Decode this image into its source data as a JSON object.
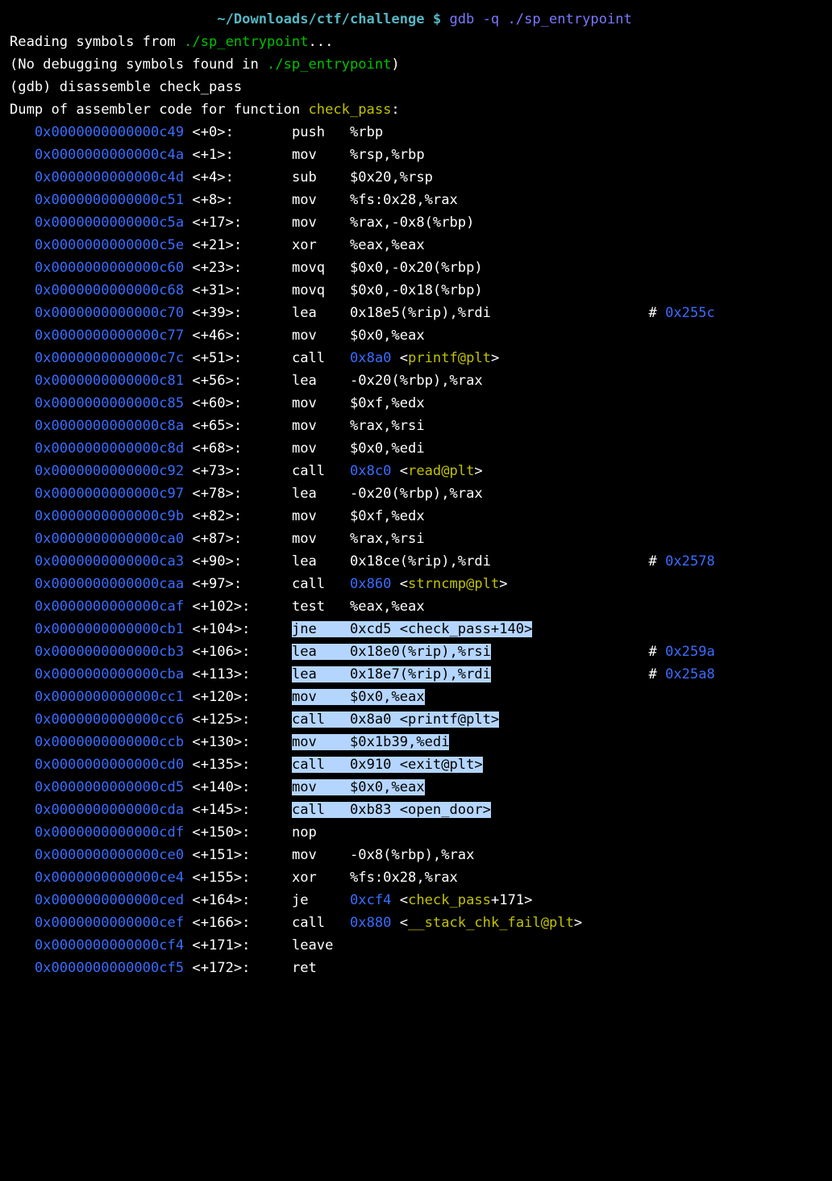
{
  "prompt_prefix_blank": "                         ",
  "cwd": "~/Downloads/ctf/challenge",
  "prompt_dollar": " $ ",
  "command": "gdb -q ./sp_entrypoint",
  "line_reading_1": "Reading symbols from ",
  "line_reading_2": "./sp_entrypoint",
  "line_reading_3": "...",
  "line_nodebug_1": "(No debugging symbols found in ",
  "line_nodebug_2": "./sp_entrypoint",
  "line_nodebug_3": ")",
  "gdb_prompt": "(gdb) ",
  "gdb_cmd": "disassemble check_pass",
  "dump_1": "Dump of assembler code for function ",
  "dump_fn": "check_pass",
  "dump_2": ":",
  "indent": "   ",
  "disasm": [
    {
      "addr": "0x0000000000000c49",
      "off": "<+0>:",
      "mnem": "push",
      "ops": [
        {
          "t": "%rbp",
          "c": "w"
        }
      ]
    },
    {
      "addr": "0x0000000000000c4a",
      "off": "<+1>:",
      "mnem": "mov",
      "ops": [
        {
          "t": "%rsp,%rbp",
          "c": "w"
        }
      ]
    },
    {
      "addr": "0x0000000000000c4d",
      "off": "<+4>:",
      "mnem": "sub",
      "ops": [
        {
          "t": "$0x20,%rsp",
          "c": "w"
        }
      ]
    },
    {
      "addr": "0x0000000000000c51",
      "off": "<+8>:",
      "mnem": "mov",
      "ops": [
        {
          "t": "%fs:0x28,%rax",
          "c": "w"
        }
      ]
    },
    {
      "addr": "0x0000000000000c5a",
      "off": "<+17>:",
      "mnem": "mov",
      "ops": [
        {
          "t": "%rax,-0x8(%rbp)",
          "c": "w"
        }
      ]
    },
    {
      "addr": "0x0000000000000c5e",
      "off": "<+21>:",
      "mnem": "xor",
      "ops": [
        {
          "t": "%eax,%eax",
          "c": "w"
        }
      ]
    },
    {
      "addr": "0x0000000000000c60",
      "off": "<+23>:",
      "mnem": "movq",
      "ops": [
        {
          "t": "$0x0,-0x20(%rbp)",
          "c": "w"
        }
      ]
    },
    {
      "addr": "0x0000000000000c68",
      "off": "<+31>:",
      "mnem": "movq",
      "ops": [
        {
          "t": "$0x0,-0x18(%rbp)",
          "c": "w"
        }
      ]
    },
    {
      "addr": "0x0000000000000c70",
      "off": "<+39>:",
      "mnem": "lea",
      "ops": [
        {
          "t": "0x18e5(%rip),%rdi",
          "c": "w"
        }
      ],
      "comment_addr": "0x255c"
    },
    {
      "addr": "0x0000000000000c77",
      "off": "<+46>:",
      "mnem": "mov",
      "ops": [
        {
          "t": "$0x0,%eax",
          "c": "w"
        }
      ]
    },
    {
      "addr": "0x0000000000000c7c",
      "off": "<+51>:",
      "mnem": "call",
      "ops": [
        {
          "t": "0x8a0",
          "c": "b"
        },
        {
          "t": " <",
          "c": "w"
        },
        {
          "t": "printf@plt",
          "c": "y"
        },
        {
          "t": ">",
          "c": "w"
        }
      ]
    },
    {
      "addr": "0x0000000000000c81",
      "off": "<+56>:",
      "mnem": "lea",
      "ops": [
        {
          "t": "-0x20(%rbp),%rax",
          "c": "w"
        }
      ]
    },
    {
      "addr": "0x0000000000000c85",
      "off": "<+60>:",
      "mnem": "mov",
      "ops": [
        {
          "t": "$0xf,%edx",
          "c": "w"
        }
      ]
    },
    {
      "addr": "0x0000000000000c8a",
      "off": "<+65>:",
      "mnem": "mov",
      "ops": [
        {
          "t": "%rax,%rsi",
          "c": "w"
        }
      ]
    },
    {
      "addr": "0x0000000000000c8d",
      "off": "<+68>:",
      "mnem": "mov",
      "ops": [
        {
          "t": "$0x0,%edi",
          "c": "w"
        }
      ]
    },
    {
      "addr": "0x0000000000000c92",
      "off": "<+73>:",
      "mnem": "call",
      "ops": [
        {
          "t": "0x8c0",
          "c": "b"
        },
        {
          "t": " <",
          "c": "w"
        },
        {
          "t": "read@plt",
          "c": "y"
        },
        {
          "t": ">",
          "c": "w"
        }
      ]
    },
    {
      "addr": "0x0000000000000c97",
      "off": "<+78>:",
      "mnem": "lea",
      "ops": [
        {
          "t": "-0x20(%rbp),%rax",
          "c": "w"
        }
      ]
    },
    {
      "addr": "0x0000000000000c9b",
      "off": "<+82>:",
      "mnem": "mov",
      "ops": [
        {
          "t": "$0xf,%edx",
          "c": "w"
        }
      ]
    },
    {
      "addr": "0x0000000000000ca0",
      "off": "<+87>:",
      "mnem": "mov",
      "ops": [
        {
          "t": "%rax,%rsi",
          "c": "w"
        }
      ]
    },
    {
      "addr": "0x0000000000000ca3",
      "off": "<+90>:",
      "mnem": "lea",
      "ops": [
        {
          "t": "0x18ce(%rip),%rdi",
          "c": "w"
        }
      ],
      "comment_addr": "0x2578"
    },
    {
      "addr": "0x0000000000000caa",
      "off": "<+97>:",
      "mnem": "call",
      "ops": [
        {
          "t": "0x860",
          "c": "b"
        },
        {
          "t": " <",
          "c": "w"
        },
        {
          "t": "strncmp@plt",
          "c": "y"
        },
        {
          "t": ">",
          "c": "w"
        }
      ]
    },
    {
      "addr": "0x0000000000000caf",
      "off": "<+102>:",
      "mnem": "test",
      "ops": [
        {
          "t": "%eax,%eax",
          "c": "w"
        }
      ]
    },
    {
      "addr": "0x0000000000000cb1",
      "off": "<+104>:",
      "mnem": "jne",
      "ops": [
        {
          "t": "0xcd5 <check_pass+140>",
          "c": "s"
        }
      ],
      "sel": true
    },
    {
      "addr": "0x0000000000000cb3",
      "off": "<+106>:",
      "mnem": "lea",
      "ops": [
        {
          "t": "0x18e0(%rip),%rsi",
          "c": "s"
        }
      ],
      "comment_addr": "0x259a",
      "sel": true
    },
    {
      "addr": "0x0000000000000cba",
      "off": "<+113>:",
      "mnem": "lea",
      "ops": [
        {
          "t": "0x18e7(%rip),%rdi",
          "c": "s"
        }
      ],
      "comment_addr": "0x25a8",
      "sel": true
    },
    {
      "addr": "0x0000000000000cc1",
      "off": "<+120>:",
      "mnem": "mov",
      "ops": [
        {
          "t": "$0x0,%eax",
          "c": "s"
        }
      ],
      "sel": true
    },
    {
      "addr": "0x0000000000000cc6",
      "off": "<+125>:",
      "mnem": "call",
      "ops": [
        {
          "t": "0x8a0 <printf@plt>",
          "c": "s"
        }
      ],
      "sel": true
    },
    {
      "addr": "0x0000000000000ccb",
      "off": "<+130>:",
      "mnem": "mov",
      "ops": [
        {
          "t": "$0x1b39,%edi",
          "c": "s"
        }
      ],
      "sel": true
    },
    {
      "addr": "0x0000000000000cd0",
      "off": "<+135>:",
      "mnem": "call",
      "ops": [
        {
          "t": "0x910 <exit@plt>",
          "c": "s"
        }
      ],
      "sel": true
    },
    {
      "addr": "0x0000000000000cd5",
      "off": "<+140>:",
      "mnem": "mov",
      "ops": [
        {
          "t": "$0x0,%eax",
          "c": "s"
        }
      ],
      "sel": true
    },
    {
      "addr": "0x0000000000000cda",
      "off": "<+145>:",
      "mnem": "call",
      "ops": [
        {
          "t": "0xb83 <open_door>",
          "c": "s"
        }
      ],
      "sel": true
    },
    {
      "addr": "0x0000000000000cdf",
      "off": "<+150>:",
      "mnem": "nop",
      "ops": []
    },
    {
      "addr": "0x0000000000000ce0",
      "off": "<+151>:",
      "mnem": "mov",
      "ops": [
        {
          "t": "-0x8(%rbp),%rax",
          "c": "w"
        }
      ]
    },
    {
      "addr": "0x0000000000000ce4",
      "off": "<+155>:",
      "mnem": "xor",
      "ops": [
        {
          "t": "%fs:0x28,%rax",
          "c": "w"
        }
      ]
    },
    {
      "addr": "0x0000000000000ced",
      "off": "<+164>:",
      "mnem": "je",
      "ops": [
        {
          "t": "0xcf4",
          "c": "b"
        },
        {
          "t": " <",
          "c": "w"
        },
        {
          "t": "check_pass",
          "c": "y"
        },
        {
          "t": "+171>",
          "c": "w"
        }
      ]
    },
    {
      "addr": "0x0000000000000cef",
      "off": "<+166>:",
      "mnem": "call",
      "ops": [
        {
          "t": "0x880",
          "c": "b"
        },
        {
          "t": " <",
          "c": "w"
        },
        {
          "t": "__stack_chk_fail@plt",
          "c": "y"
        },
        {
          "t": ">",
          "c": "w"
        }
      ]
    },
    {
      "addr": "0x0000000000000cf4",
      "off": "<+171>:",
      "mnem": "leave",
      "ops": []
    },
    {
      "addr": "0x0000000000000cf5",
      "off": "<+172>:",
      "mnem": "ret",
      "ops": []
    }
  ]
}
